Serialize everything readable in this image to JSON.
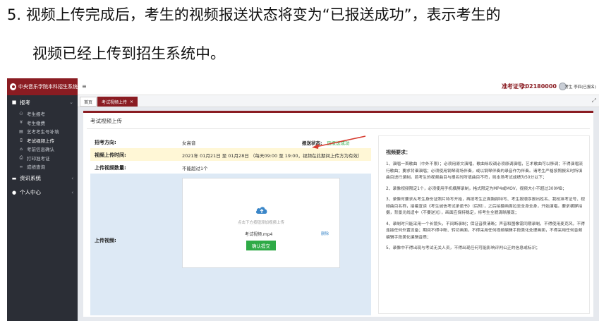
{
  "document": {
    "line1": "5. 视频上传完成后，考生的视频报送状态将变为“已报送成功”，表示考生的",
    "line2": "视频已经上传到招生系统中。"
  },
  "app": {
    "logo_text": "中央音乐学院本科招生系统",
    "sidebar": {
      "groups": [
        {
          "label": "报考",
          "icon": "briefcase-icon"
        },
        {
          "label": "资讯系统",
          "icon": "info-icon"
        },
        {
          "label": "个人中心",
          "icon": "user-icon"
        }
      ],
      "items": [
        {
          "label": "考生报考"
        },
        {
          "label": "考生缴费"
        },
        {
          "label": "艺考考生号补填"
        },
        {
          "label": "考试视频上传"
        },
        {
          "label": "考前信息确认"
        },
        {
          "label": "打印准考证"
        },
        {
          "label": "成绩查询"
        }
      ]
    },
    "topbar": {
      "exam_label": "准考证号：",
      "exam_no": "202180000",
      "user": "考生 李四(已报名)"
    },
    "tabs": {
      "home": "首页",
      "current": "考试视频上传"
    },
    "panel": {
      "title": "考试视频上传",
      "fields": {
        "major_label": "招考方向:",
        "major_value": "女高音",
        "status_label": "报送状态:",
        "status_value": "已报送成功",
        "time_label": "视频上传时间:",
        "time_value": "2021年 01月21日 至 01月28日 （每天09:00 至 19:00，视频在此期间上传方为有效）",
        "count_label": "上传视频数量:",
        "count_value": "不能超过1个",
        "upload_label": "上传视频:"
      },
      "upload": {
        "hint": "点击下方按钮添加视频上传",
        "file_name": "考试视频.mp4",
        "delete": "删除",
        "confirm": "确认提交"
      },
      "requirements": {
        "title": "视频要求：",
        "items": [
          "1、演唱一首歌曲（中外不限）；必须用原文演唱，歌曲咏叹调必须原调演唱，艺术歌曲可以移调；不得演唱流行歌曲；要求背谱演唱；必须使用钢琴现场伴奏，或以钢琴伴奏的录音作为伴奏。请考生严格按照报名时所填曲目进行录制。若考生的视频曲目与报名时所填曲目不符，则本场考试成绩为50分以下；",
          "2、录像视频限定1个，必须使用手机横屏录制，格式限定为MP4或MOV，视频大小不超过300MB；",
          "3、录像时要求从考生身份证照片特写开始，再按考生正面胸部特写、考生按顺序报出姓名、我校准考证号、视频曲目名称，接着宣读《考生诚信考试承诺书》（后附），之后拍摄画面拉至全身全身，开始演唱。要求横屏拍摄，背景光线适中（不要逆光），画面应保持稳定，将考生全貌清晰展现；",
          "4、录制时只能采用一个长镜头，不间断录制；保证音质清晰；声音和图像需同期录制，不得使用麦克风，不得连接任何外置设备；期间不得中断、转切画面，不得采用任何视频编辑手段美化处理画面，不得采用任何音频编辑手段美化编辑音质；",
          "5、录像中不得出现与考试无关人员，不得出现任何可能影响评判公正的信息或标识；"
        ]
      }
    },
    "colors": {
      "brand": "#8a1c22",
      "success": "#2eaa46",
      "highlight": "#fff7d6",
      "sidebar": "#2b2e36",
      "annotation_arrow": "#d63b2f"
    }
  }
}
